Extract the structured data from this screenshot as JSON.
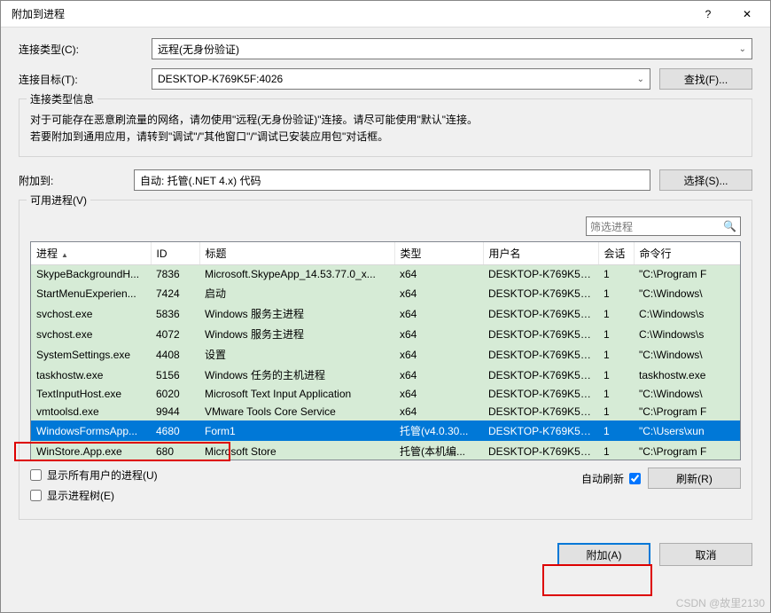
{
  "window": {
    "title": "附加到进程"
  },
  "labels": {
    "conn_type": "连接类型(C):",
    "conn_target": "连接目标(T):",
    "find_btn": "查找(F)...",
    "conn_info_legend": "连接类型信息",
    "conn_info_line1": "对于可能存在恶意刷流量的网络，请勿使用\"远程(无身份验证)\"连接。请尽可能使用\"默认\"连接。",
    "conn_info_line2": "若要附加到通用应用，请转到\"调试\"/\"其他窗口\"/\"调试已安装应用包\"对话框。",
    "attach_to": "附加到:",
    "select_btn": "选择(S)...",
    "avail_legend": "可用进程(V)",
    "search_placeholder": "筛选进程",
    "show_all": "显示所有用户的进程(U)",
    "show_tree": "显示进程树(E)",
    "auto_refresh": "自动刷新",
    "refresh_btn": "刷新(R)",
    "attach_btn": "附加(A)",
    "cancel_btn": "取消"
  },
  "fields": {
    "conn_type_value": "远程(无身份验证)",
    "conn_target_value": "DESKTOP-K769K5F:4026",
    "attach_to_value": "自动: 托管(.NET 4.x) 代码"
  },
  "columns": {
    "proc": "进程",
    "id": "ID",
    "title": "标题",
    "type": "类型",
    "user": "用户名",
    "sess": "会话",
    "cmd": "命令行"
  },
  "rows": [
    {
      "proc": "SkypeBackgroundH...",
      "id": "7836",
      "title": "Microsoft.SkypeApp_14.53.77.0_x...",
      "type": "x64",
      "user": "DESKTOP-K769K5F...",
      "sess": "1",
      "cmd": "\"C:\\Program F"
    },
    {
      "proc": "StartMenuExperien...",
      "id": "7424",
      "title": "启动",
      "type": "x64",
      "user": "DESKTOP-K769K5F...",
      "sess": "1",
      "cmd": "\"C:\\Windows\\"
    },
    {
      "proc": "svchost.exe",
      "id": "5836",
      "title": "Windows 服务主进程",
      "type": "x64",
      "user": "DESKTOP-K769K5F...",
      "sess": "1",
      "cmd": "C:\\Windows\\s"
    },
    {
      "proc": "svchost.exe",
      "id": "4072",
      "title": "Windows 服务主进程",
      "type": "x64",
      "user": "DESKTOP-K769K5F...",
      "sess": "1",
      "cmd": "C:\\Windows\\s"
    },
    {
      "proc": "SystemSettings.exe",
      "id": "4408",
      "title": "设置",
      "type": "x64",
      "user": "DESKTOP-K769K5F...",
      "sess": "1",
      "cmd": "\"C:\\Windows\\"
    },
    {
      "proc": "taskhostw.exe",
      "id": "5156",
      "title": "Windows 任务的主机进程",
      "type": "x64",
      "user": "DESKTOP-K769K5F...",
      "sess": "1",
      "cmd": "taskhostw.exe"
    },
    {
      "proc": "TextInputHost.exe",
      "id": "6020",
      "title": "Microsoft Text Input Application",
      "type": "x64",
      "user": "DESKTOP-K769K5F...",
      "sess": "1",
      "cmd": "\"C:\\Windows\\"
    },
    {
      "proc": "vmtoolsd.exe",
      "id": "9944",
      "title": "VMware Tools Core Service",
      "type": "x64",
      "user": "DESKTOP-K769K5F...",
      "sess": "1",
      "cmd": "\"C:\\Program F"
    },
    {
      "proc": "WindowsFormsApp...",
      "id": "4680",
      "title": "Form1",
      "type": "托管(v4.0.30...",
      "user": "DESKTOP-K769K5F...",
      "sess": "1",
      "cmd": "\"C:\\Users\\xun",
      "selected": true
    },
    {
      "proc": "WinStore.App.exe",
      "id": "680",
      "title": "Microsoft Store",
      "type": "托管(本机编...",
      "user": "DESKTOP-K769K5F...",
      "sess": "1",
      "cmd": "\"C:\\Program F"
    }
  ],
  "watermark": "CSDN @故里2130"
}
